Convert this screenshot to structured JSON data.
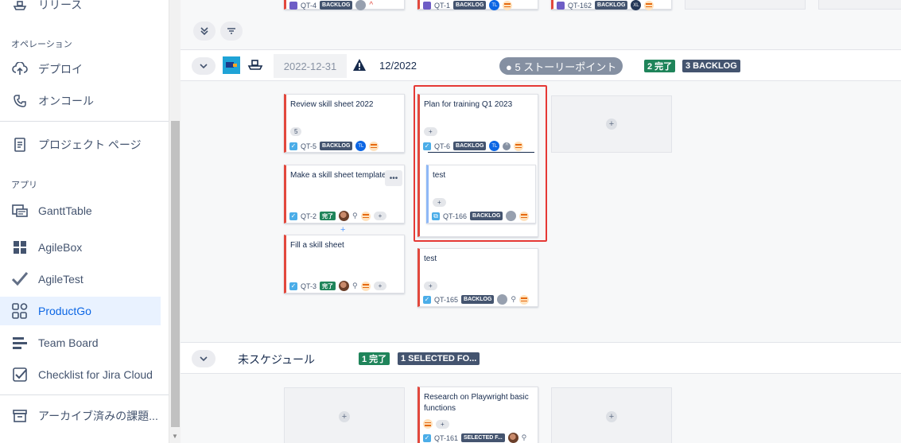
{
  "sidebar": {
    "top_item": {
      "label": "リリース",
      "icon": "ship-icon"
    },
    "sections": [
      {
        "title": "オペレーション"
      },
      {
        "title": "アプリ"
      }
    ],
    "operation_items": [
      {
        "label": "デプロイ",
        "icon": "cloud-upload-icon"
      },
      {
        "label": "オンコール",
        "icon": "phone-icon"
      }
    ],
    "project_page": {
      "label": "プロジェクト ページ",
      "icon": "page-icon"
    },
    "apps": [
      {
        "label": "GanttTable",
        "icon": "gantt-icon"
      },
      {
        "label": "AgileBox",
        "icon": "grid-icon"
      },
      {
        "label": "AgileTest",
        "icon": "check-mark-icon"
      },
      {
        "label": "ProductGo",
        "icon": "productgo-icon",
        "active": true
      },
      {
        "label": "Team Board",
        "icon": "team-board-icon"
      },
      {
        "label": "Checklist for Jira Cloud",
        "icon": "checklist-icon"
      }
    ],
    "archive": {
      "label": "アーカイブ済みの課題...",
      "icon": "archive-icon"
    }
  },
  "top_cards": [
    {
      "key": "QT-4",
      "status": "BACKLOG"
    },
    {
      "key": "QT-1",
      "status": "BACKLOG",
      "avatar": "TL"
    },
    {
      "key": "QT-162",
      "status": "BACKLOG",
      "avatar": "XL"
    }
  ],
  "sprint": {
    "date": "2022-12-31",
    "name": "12/2022",
    "story_points": "● 5 ストーリーポイント",
    "done_badge": "2 完了",
    "backlog_badge": "3 BACKLOG"
  },
  "column1": [
    {
      "title": "Review skill sheet 2022",
      "points": "5",
      "key": "QT-5",
      "status": "BACKLOG",
      "avatar": "TL"
    },
    {
      "title": "Make a skill sheet template",
      "key": "QT-2",
      "status": "完了",
      "more": "•••",
      "plus": "+"
    },
    {
      "title": "Fill a skill sheet",
      "key": "QT-3",
      "status": "完了",
      "plus": "+"
    }
  ],
  "column2": [
    {
      "title": "Plan for training Q1 2023",
      "plus": "+",
      "key": "QT-6",
      "status": "BACKLOG",
      "avatar": "TL"
    },
    {
      "title": "test",
      "plus": "+",
      "key": "QT-166",
      "status": "BACKLOG"
    },
    {
      "title": "test",
      "plus": "+",
      "key": "QT-165",
      "status": "BACKLOG"
    }
  ],
  "add_between": "+",
  "empty_slot_plus": "+",
  "unscheduled": {
    "label": "未スケジュール",
    "done_badge": "1 完了",
    "selected_badge": "1 SELECTED FO...",
    "card": {
      "title": "Research on Playwright basic functions",
      "plus": "+",
      "key": "QT-161",
      "status": "SELECTED F..."
    }
  },
  "colors": {
    "accent": "#0c66e4",
    "danger_stripe": "#e2483d",
    "done": "#1f845a",
    "backlog": "#44546f",
    "highlight": "#e53935"
  }
}
